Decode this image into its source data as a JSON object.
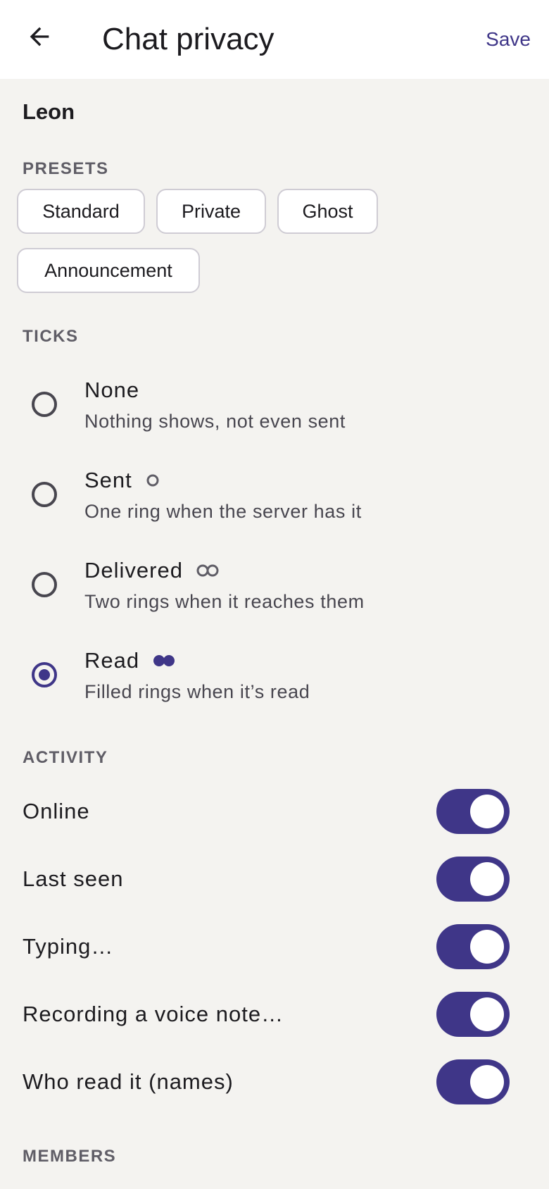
{
  "appbar": {
    "title": "Chat privacy",
    "save_label": "Save",
    "back_icon": "arrow-left-icon"
  },
  "chat": {
    "name": "Leon"
  },
  "presets": {
    "header": "PRESETS",
    "chips": [
      "Standard",
      "Private",
      "Ghost",
      "Announcement"
    ]
  },
  "ticks": {
    "header": "TICKS",
    "selected": "Read",
    "options": [
      {
        "title": "None",
        "description": "Nothing shows, not even sent",
        "glyph": "none",
        "checked": false
      },
      {
        "title": "Sent",
        "description": "One ring when the server has it",
        "glyph": "single-ring-icon",
        "checked": false
      },
      {
        "title": "Delivered",
        "description": "Two rings when it reaches them",
        "glyph": "double-ring-icon",
        "checked": false
      },
      {
        "title": "Read",
        "description": "Filled rings when it’s read",
        "glyph": "double-filled-ring-icon",
        "checked": true
      }
    ]
  },
  "activity": {
    "header": "ACTIVITY",
    "toggles": [
      {
        "label": "Online",
        "on": true
      },
      {
        "label": "Last seen",
        "on": true
      },
      {
        "label": "Typing…",
        "on": true
      },
      {
        "label": "Recording a voice note…",
        "on": true
      },
      {
        "label": "Who read it (names)",
        "on": true
      }
    ]
  },
  "members": {
    "header": "MEMBERS"
  },
  "colors": {
    "accent": "#3f3688",
    "background": "#f4f3f0",
    "appbar": "#ffffff",
    "section_header": "#5f5d66"
  }
}
